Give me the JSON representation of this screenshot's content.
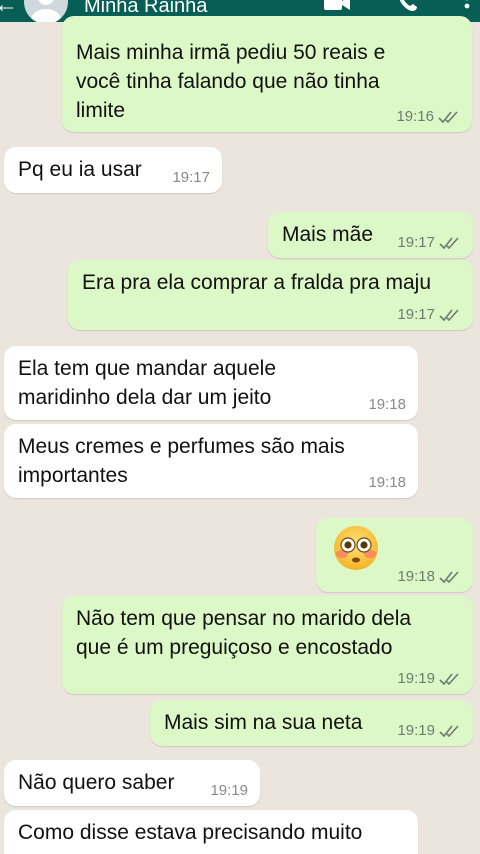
{
  "header": {
    "contact_name": "Minha Rainha",
    "back_icon": "arrow-back-icon",
    "avatar_icon": "default-avatar-icon",
    "video_icon": "video-camera-icon",
    "call_icon": "phone-icon",
    "menu_icon": "more-vert-icon",
    "color": "#075e54"
  },
  "colors": {
    "outgoing_bubble": "#dcf8c6",
    "incoming_bubble": "#ffffff",
    "chat_background": "#ece5dd",
    "read_ticks": "#6f7b71"
  },
  "messages": [
    {
      "direction": "out",
      "lines": [
        "Mais minha irmã pediu 50 reais e",
        "você tinha falando que não tinha",
        "limite"
      ],
      "time": "19:16",
      "status": "delivered"
    },
    {
      "direction": "in",
      "lines": [
        "Pq eu ia usar"
      ],
      "time": "19:17"
    },
    {
      "direction": "out",
      "lines": [
        "Mais mãe"
      ],
      "time": "19:17",
      "status": "delivered"
    },
    {
      "direction": "out",
      "lines": [
        "Era pra ela comprar a fralda pra maju"
      ],
      "time": "19:17",
      "status": "delivered"
    },
    {
      "direction": "in",
      "lines": [
        "Ela tem que mandar aquele",
        "maridinho dela dar um jeito"
      ],
      "time": "19:18"
    },
    {
      "direction": "in",
      "lines": [
        "Meus cremes e perfumes são mais",
        "importantes"
      ],
      "time": "19:18"
    },
    {
      "direction": "out",
      "emoji": "flushed-face-emoji",
      "time": "19:18",
      "status": "delivered"
    },
    {
      "direction": "out",
      "lines": [
        "Não tem que pensar no marido dela",
        "que é um preguiçoso e encostado"
      ],
      "time": "19:19",
      "status": "delivered"
    },
    {
      "direction": "out",
      "lines": [
        "Mais sim na sua neta"
      ],
      "time": "19:19",
      "status": "delivered"
    },
    {
      "direction": "in",
      "lines": [
        "Não quero saber"
      ],
      "time": "19:19"
    },
    {
      "direction": "in",
      "lines": [
        "Como disse estava precisando muito"
      ],
      "time": ""
    }
  ]
}
